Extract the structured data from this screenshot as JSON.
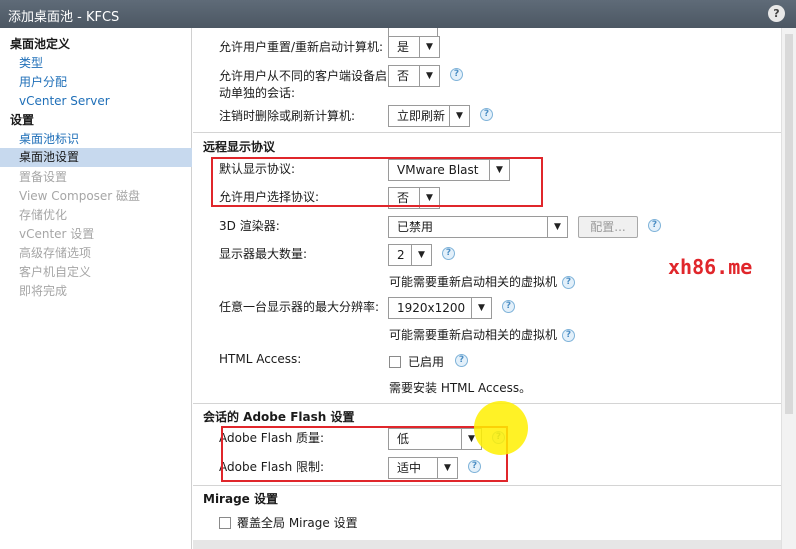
{
  "window": {
    "title": "添加桌面池 - KFCS",
    "help_label": "?"
  },
  "sidebar": {
    "groups": [
      {
        "label": "桌面池定义",
        "items": [
          {
            "label": "类型",
            "state": "link"
          },
          {
            "label": "用户分配",
            "state": "link"
          },
          {
            "label": "vCenter Server",
            "state": "link"
          }
        ]
      },
      {
        "label": "设置",
        "items": [
          {
            "label": "桌面池标识",
            "state": "link"
          },
          {
            "label": "桌面池设置",
            "state": "selected"
          },
          {
            "label": "置备设置",
            "state": "disabled"
          },
          {
            "label": "View Composer 磁盘",
            "state": "disabled"
          },
          {
            "label": "存储优化",
            "state": "disabled"
          },
          {
            "label": "vCenter 设置",
            "state": "disabled"
          },
          {
            "label": "高级存储选项",
            "state": "disabled"
          },
          {
            "label": "客户机自定义",
            "state": "disabled"
          },
          {
            "label": "即将完成",
            "state": "disabled"
          }
        ]
      }
    ]
  },
  "settings": {
    "allow_reset": {
      "label": "允许用户重置/重新启动计算机:",
      "value": "是"
    },
    "separate_sessions": {
      "label_line1": "允许用户从不同的客户端设备启",
      "label_line2": "动单独的会话:",
      "value": "否"
    },
    "logoff_action": {
      "label": "注销时删除或刷新计算机:",
      "value": "立即刷新"
    }
  },
  "remote_display": {
    "heading": "远程显示协议",
    "default_protocol": {
      "label": "默认显示协议:",
      "value": "VMware Blast"
    },
    "allow_choose": {
      "label": "允许用户选择协议:",
      "value": "否"
    },
    "renderer_3d": {
      "label": "3D 渲染器:",
      "value": "已禁用",
      "configure_label": "配置..."
    },
    "max_monitors": {
      "label": "显示器最大数量:",
      "value": "2"
    },
    "restart_note_1": "可能需要重新启动相关的虚拟机",
    "max_resolution": {
      "label": "任意一台显示器的最大分辨率:",
      "value": "1920x1200"
    },
    "restart_note_2": "可能需要重新启动相关的虚拟机",
    "html_access": {
      "label": "HTML Access:",
      "checkbox_label": "已启用",
      "checked": false,
      "note": "需要安装 HTML Access。"
    }
  },
  "flash": {
    "heading": "会话的 Adobe Flash 设置",
    "quality": {
      "label": "Adobe Flash 质量:",
      "value": "低"
    },
    "throttling": {
      "label": "Adobe Flash 限制:",
      "value": "适中"
    }
  },
  "mirage": {
    "heading": "Mirage 设置",
    "override": {
      "label": "覆盖全局 Mirage 设置",
      "checked": false
    }
  },
  "watermark": "xh86.me",
  "icons": {
    "help": "?",
    "dropdown": "▼"
  },
  "colors": {
    "highlight_box": "#e0262b",
    "link": "#1f6fb8",
    "selected_bg": "#c7d9ee",
    "cursor_highlight": "#fff000"
  }
}
